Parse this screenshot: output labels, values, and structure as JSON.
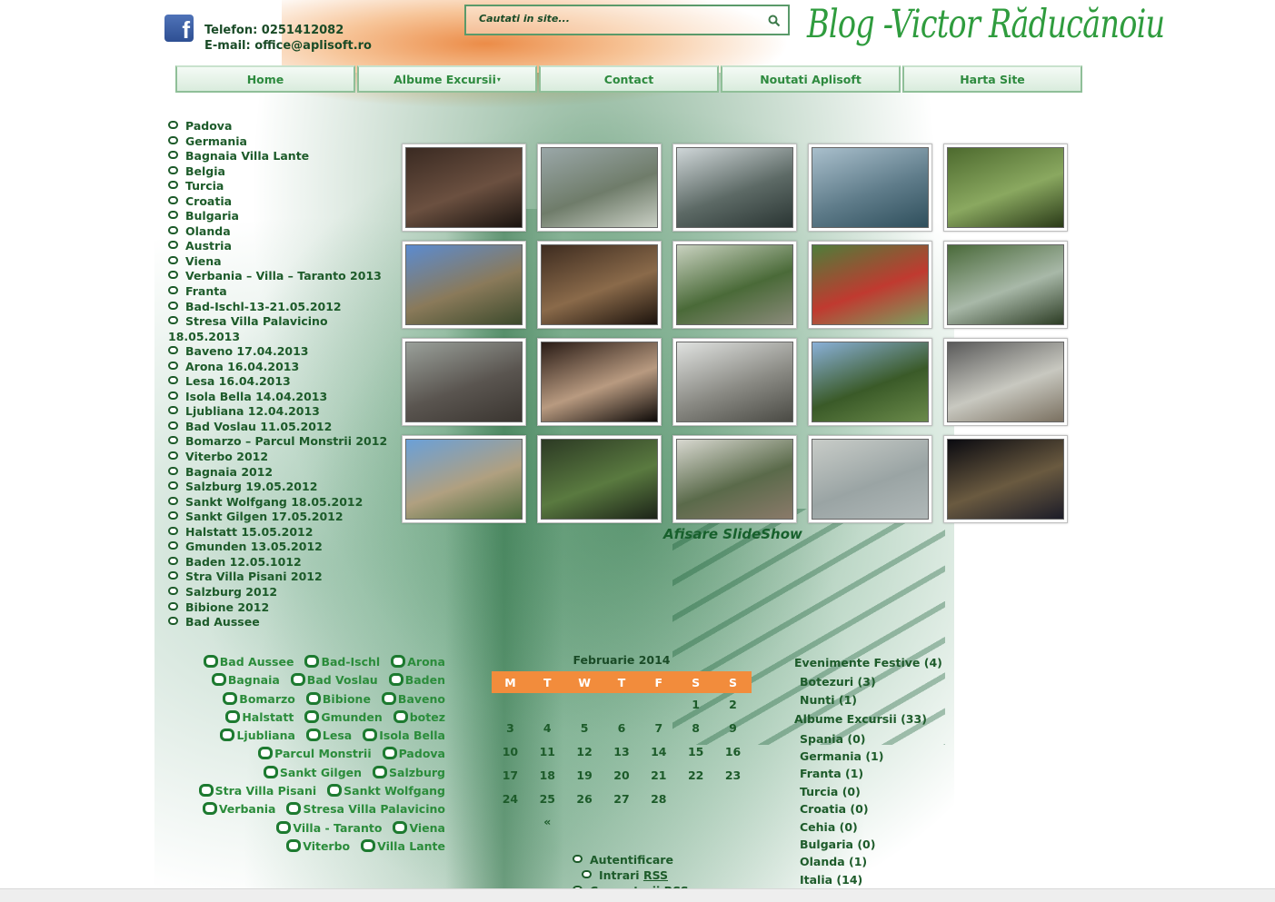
{
  "header": {
    "phone": "Telefon: 0251412082",
    "email": "E-mail: office@aplisoft.ro",
    "search_placeholder": "Cautati in site...",
    "blog_title": "Blog  -Victor Răducănoiu",
    "facebook_letter": "f"
  },
  "nav": [
    "Home",
    "Albume Excursii",
    "Contact",
    "Noutati Aplisoft",
    "Harta Site"
  ],
  "nav_caret": "▾",
  "albums": [
    "Padova",
    "Germania",
    "Bagnaia Villa Lante",
    "Belgia",
    "Turcia",
    "Croatia",
    "Bulgaria",
    "Olanda",
    "Austria",
    "Viena",
    "Verbania – Villa – Taranto 2013",
    "Franta",
    "Bad-Ischl-13-21.05.2012",
    "Stresa Villa Palavicino 18.05.2013",
    "Baveno 17.04.2013",
    "Arona 16.04.2013",
    "Lesa 16.04.2013",
    "Isola Bella 14.04.2013",
    "Ljubliana 12.04.2013",
    "Bad Voslau 11.05.2012",
    "Bomarzo – Parcul Monstrii 2012",
    "Viterbo 2012",
    "Bagnaia 2012",
    "Salzburg 19.05.2012",
    "Sankt Wolfgang 18.05.2012",
    "Sankt Gilgen 17.05.2012",
    "Halstatt 15.05.2012",
    "Gmunden 13.05.2012",
    "Baden 12.05.1012",
    "Stra Villa Pisani 2012",
    "Salzburg 2012",
    "Bibione 2012",
    "Bad Aussee"
  ],
  "thumbnails": [
    {
      "colors": [
        "#3a2a22",
        "#6b5040",
        "#1a1410"
      ]
    },
    {
      "colors": [
        "#9aa7a8",
        "#6f7c6a",
        "#c9cfc4"
      ]
    },
    {
      "colors": [
        "#cfd6d8",
        "#5d6a66",
        "#2a3533"
      ]
    },
    {
      "colors": [
        "#a9bfcc",
        "#5f7c8a",
        "#2f4f5c"
      ]
    },
    {
      "colors": [
        "#4d6a2e",
        "#8aa860",
        "#2a3a18"
      ]
    },
    {
      "colors": [
        "#5b8bd0",
        "#8a7a5a",
        "#3c4a2c"
      ]
    },
    {
      "colors": [
        "#3e2c20",
        "#8a6a4a",
        "#1c130d"
      ]
    },
    {
      "colors": [
        "#c9d2c0",
        "#4a6a38",
        "#8a8a7a"
      ]
    },
    {
      "colors": [
        "#4e7d3a",
        "#c03a30",
        "#7aa060"
      ]
    },
    {
      "colors": [
        "#4a6a3a",
        "#a8b8a8",
        "#2c3c24"
      ]
    },
    {
      "colors": [
        "#9aa09a",
        "#5a5550",
        "#3a3530"
      ]
    },
    {
      "colors": [
        "#2a1c16",
        "#b89a80",
        "#0e0a08"
      ]
    },
    {
      "colors": [
        "#e0e2e0",
        "#8a8a84",
        "#4a4a44"
      ]
    },
    {
      "colors": [
        "#8ab0d8",
        "#3a5a28",
        "#6a8a4a"
      ]
    },
    {
      "colors": [
        "#5a5a5a",
        "#c8c8c0",
        "#7a7060"
      ]
    },
    {
      "colors": [
        "#6aa0d8",
        "#b0a080",
        "#4a6a3a"
      ]
    },
    {
      "colors": [
        "#2c3a24",
        "#5a7a40",
        "#1c2418"
      ]
    },
    {
      "colors": [
        "#d8d8d0",
        "#5a6a4a",
        "#8a7a6a"
      ]
    },
    {
      "colors": [
        "#c8ccc8",
        "#9aa4a4",
        "#b0b8b8"
      ]
    },
    {
      "colors": [
        "#0a0a10",
        "#6a5a40",
        "#1c1c28"
      ]
    }
  ],
  "slideshow_label": "Afisare SlideShow",
  "tags": [
    "Bad Aussee",
    "Bad-Ischl",
    "Arona",
    "Bagnaia",
    "Bad Voslau",
    "Baden",
    "Bomarzo",
    "Bibione",
    "Baveno",
    "Halstatt",
    "Gmunden",
    "botez",
    "Ljubliana",
    "Lesa",
    "Isola Bella",
    "Parcul Monstrii",
    "Padova",
    "Sankt Gilgen",
    "Salzburg",
    "Stra Villa Pisani",
    "Sankt Wolfgang",
    "Verbania",
    "Stresa Villa Palavicino",
    "Villa - Taranto",
    "Viena",
    "Viterbo",
    "Villa Lante"
  ],
  "calendar": {
    "caption": "Februarie 2014",
    "days": [
      "M",
      "T",
      "W",
      "T",
      "F",
      "S",
      "S"
    ],
    "weeks": [
      [
        "",
        "",
        "",
        "",
        "",
        "1",
        "2"
      ],
      [
        "3",
        "4",
        "5",
        "6",
        "7",
        "8",
        "9"
      ],
      [
        "10",
        "11",
        "12",
        "13",
        "14",
        "15",
        "16"
      ],
      [
        "17",
        "18",
        "19",
        "20",
        "21",
        "22",
        "23"
      ],
      [
        "24",
        "25",
        "26",
        "27",
        "28",
        "",
        ""
      ]
    ],
    "prev": "«"
  },
  "meta_links": {
    "login": "Autentificare",
    "entries_prefix": "Intrari ",
    "entries_rss": "RSS",
    "comments": "Comentarii RSS"
  },
  "categories": [
    {
      "label": "Evenimente Festive (4)",
      "level": "top"
    },
    {
      "label": "Botezuri (3)",
      "level": "sub"
    },
    {
      "label": "Nunti (1)",
      "level": "sub"
    },
    {
      "label": "Albume Excursii (33)",
      "level": "top"
    },
    {
      "label": "Spania (0)",
      "level": "sub"
    },
    {
      "label": "Germania (1)",
      "level": "sub"
    },
    {
      "label": "Franta (1)",
      "level": "sub"
    },
    {
      "label": "Turcia (0)",
      "level": "sub"
    },
    {
      "label": "Croatia (0)",
      "level": "sub"
    },
    {
      "label": "Cehia (0)",
      "level": "sub"
    },
    {
      "label": "Bulgaria (0)",
      "level": "sub"
    },
    {
      "label": "Olanda (1)",
      "level": "sub"
    },
    {
      "label": "Italia (14)",
      "level": "sub"
    }
  ]
}
